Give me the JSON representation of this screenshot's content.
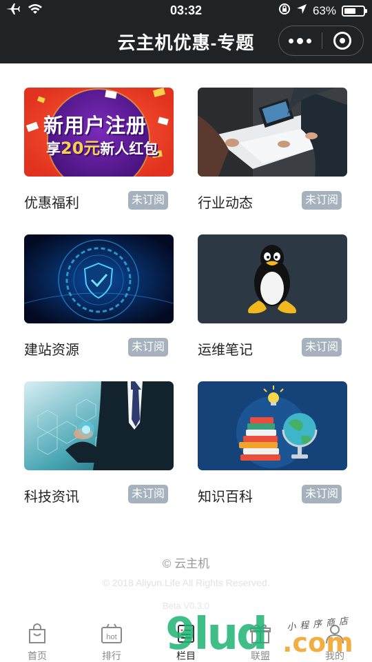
{
  "status_bar": {
    "time": "03:32",
    "battery_text": "63%",
    "battery_level": 0.63,
    "icons": [
      "airplane-icon",
      "wifi-icon",
      "orientation-lock-icon",
      "location-arrow-icon",
      "battery-icon"
    ]
  },
  "nav": {
    "title": "云主机优惠-专题"
  },
  "cards": [
    {
      "label": "优惠福利",
      "button": "未订阅",
      "banner_line1": "新用户注册",
      "banner_line2_prefix": "享",
      "banner_line2_amount": "20元",
      "banner_line2_suffix": "新人红包",
      "image": "new-user-bonus-banner"
    },
    {
      "label": "行业动态",
      "button": "未订阅",
      "image": "team-meeting-photo"
    },
    {
      "label": "建站资源",
      "button": "未订阅",
      "image": "security-shield-graphic"
    },
    {
      "label": "运维笔记",
      "button": "未订阅",
      "image": "linux-penguin-graphic"
    },
    {
      "label": "科技资讯",
      "button": "未订阅",
      "image": "tech-businessman-graphic"
    },
    {
      "label": "知识百科",
      "button": "未订阅",
      "image": "books-globe-graphic"
    }
  ],
  "footer": {
    "brand": "© 云主机",
    "copyright": "© 2018 Aliyun.Life All Rights Reserved.",
    "version": "Beta V0.3.0"
  },
  "tabs": [
    {
      "label": "首页",
      "icon": "shopping-bag-icon",
      "active": false
    },
    {
      "label": "排行",
      "icon": "hot-icon",
      "active": false
    },
    {
      "label": "栏目",
      "icon": "column-list-icon",
      "active": true
    },
    {
      "label": "联盟",
      "icon": "gift-icon",
      "active": false
    },
    {
      "label": "我的",
      "icon": "user-icon",
      "active": false
    }
  ],
  "watermark": {
    "brand": "9lud",
    "domain": ".com",
    "caption": "小程序商店"
  },
  "colors": {
    "header_bg": "#1f2326",
    "subscribe_button_bg": "#a5b1bd",
    "watermark_green": "#1fb374",
    "watermark_orange": "#f0a020"
  }
}
